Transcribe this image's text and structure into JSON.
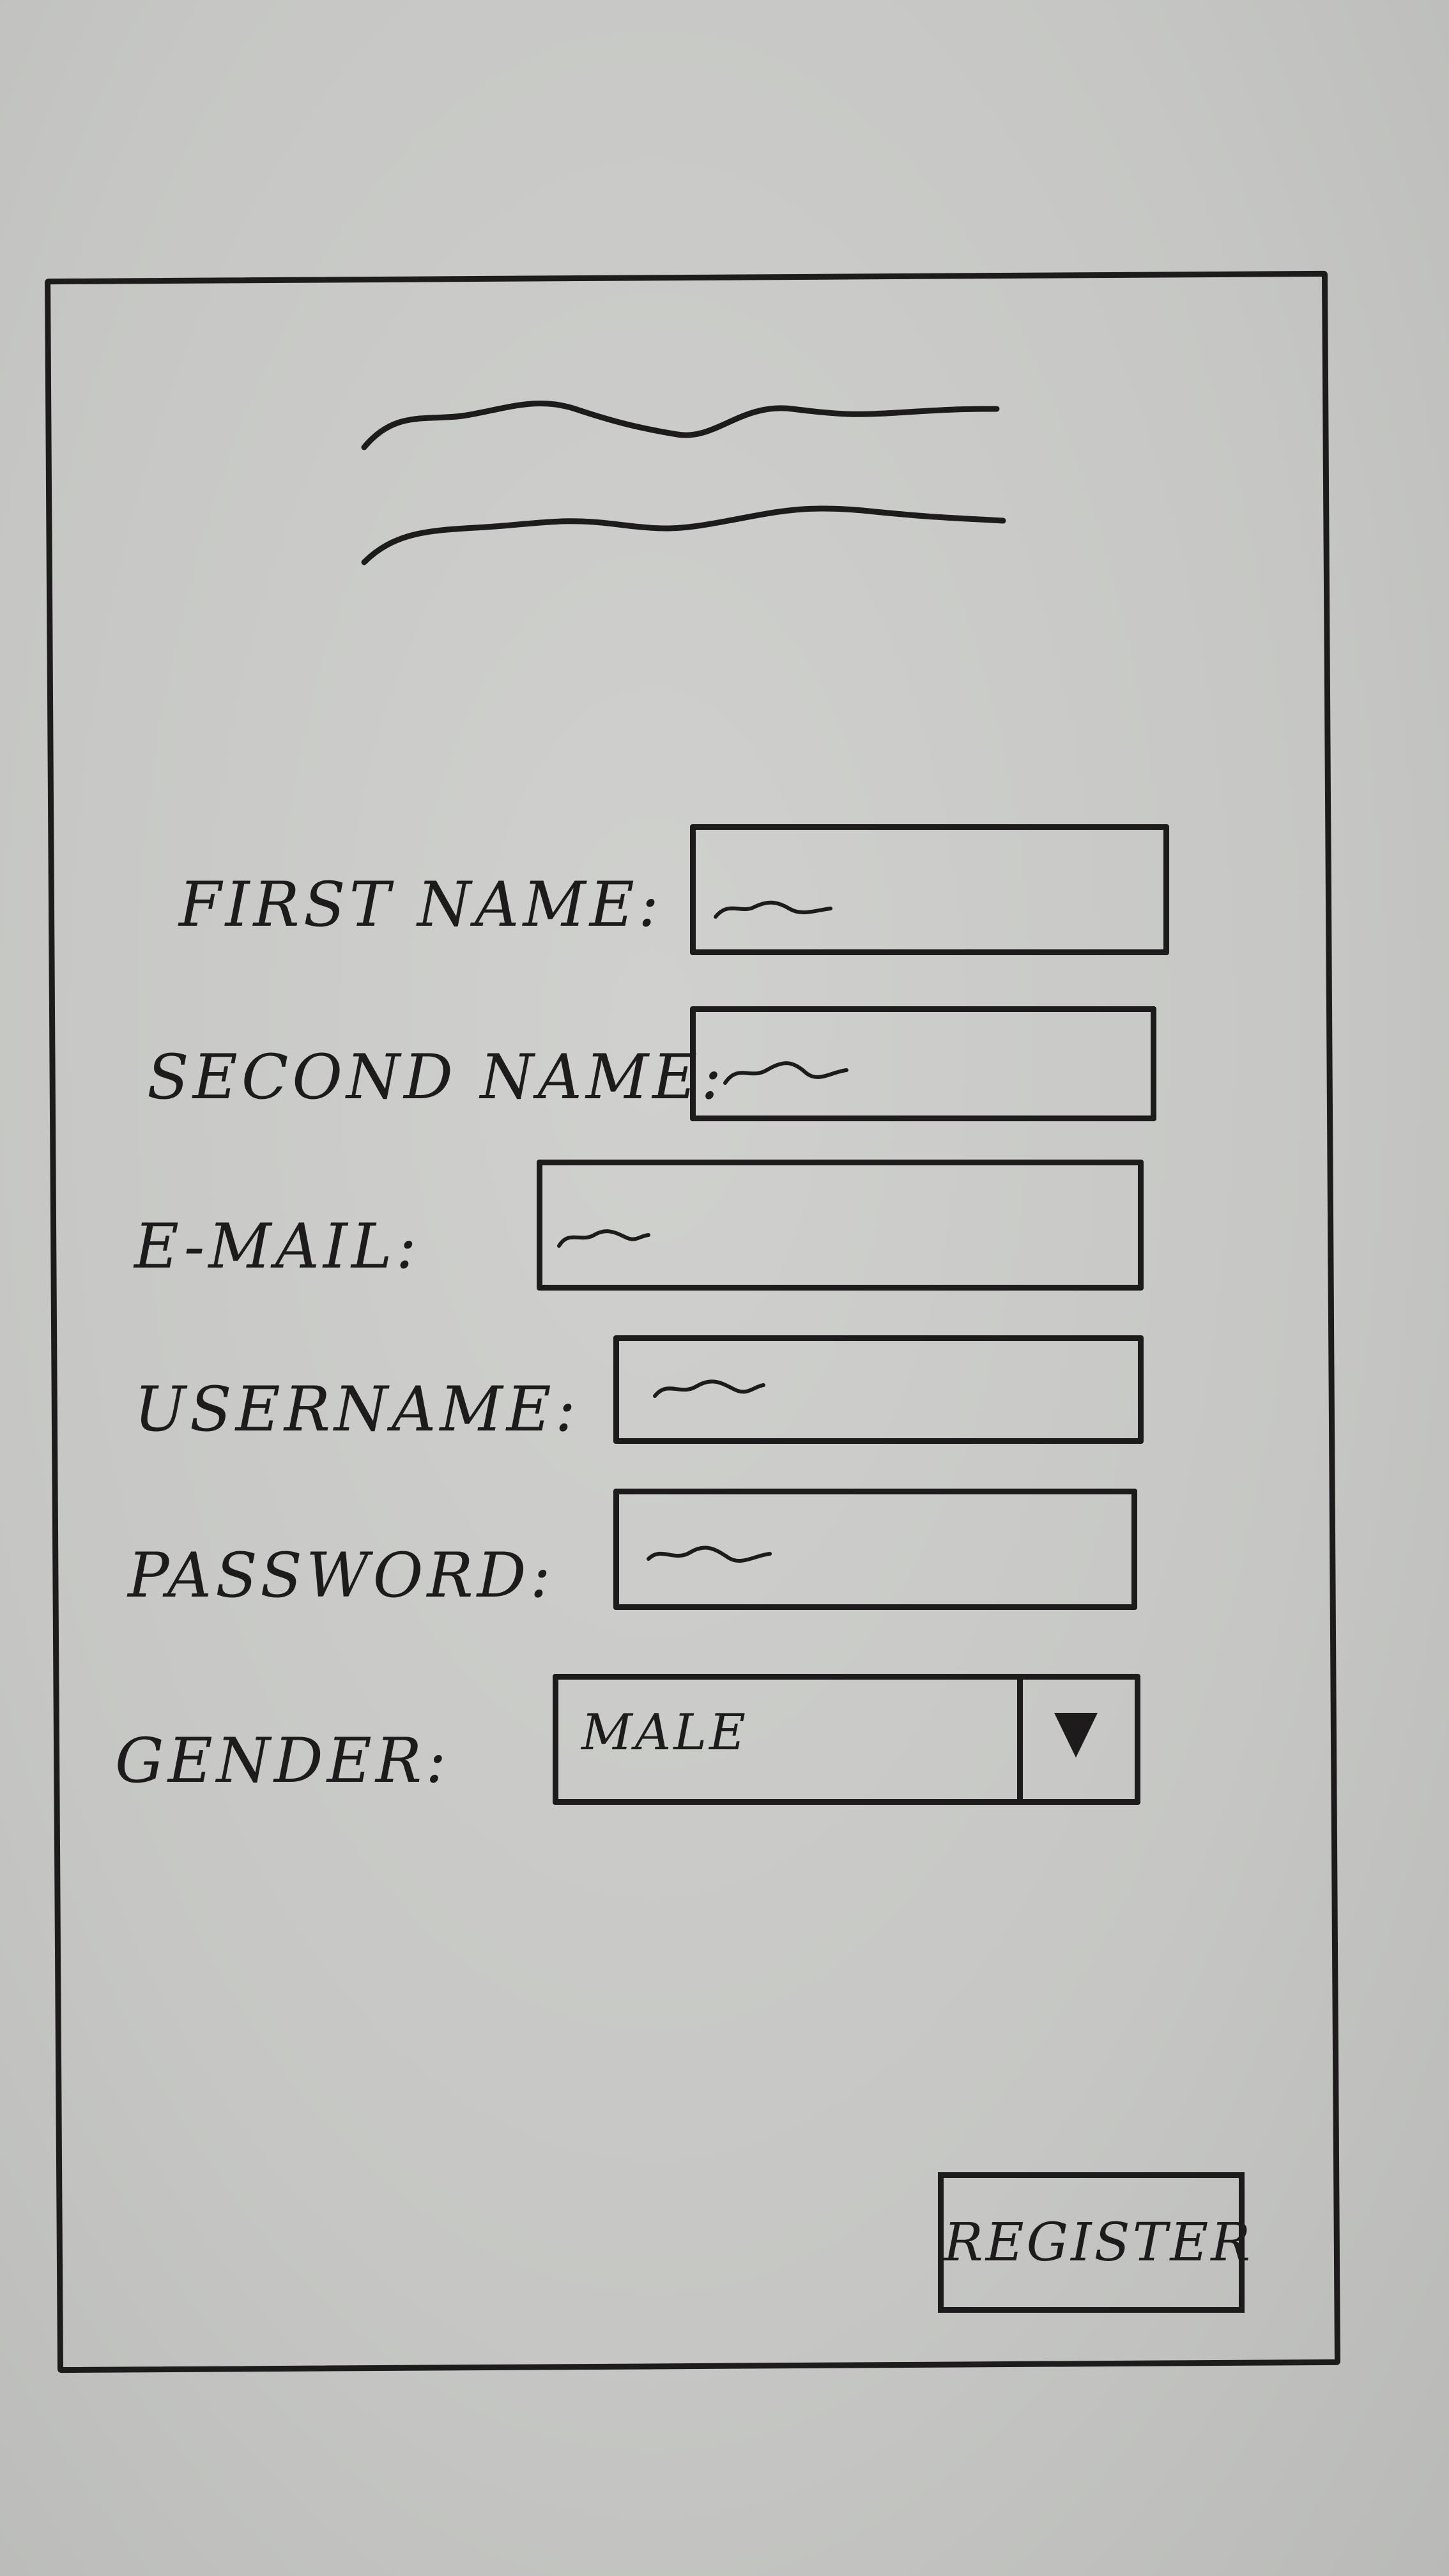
{
  "form": {
    "fields": [
      {
        "label": "FIRST NAME:",
        "value": ""
      },
      {
        "label": "SECOND NAME:",
        "value": ""
      },
      {
        "label": "E-MAIL:",
        "value": ""
      },
      {
        "label": "USERNAME:",
        "value": ""
      },
      {
        "label": "PASSWORD:",
        "value": ""
      }
    ],
    "gender": {
      "label": "GENDER:",
      "selected": "MALE"
    },
    "register_label": "REGISTER"
  },
  "icons": {
    "header": "title-placeholder-squiggle",
    "dropdown": "triangle-down-icon"
  },
  "colors": {
    "ink": "#1d1b1b",
    "paper": "#c9cac7"
  }
}
